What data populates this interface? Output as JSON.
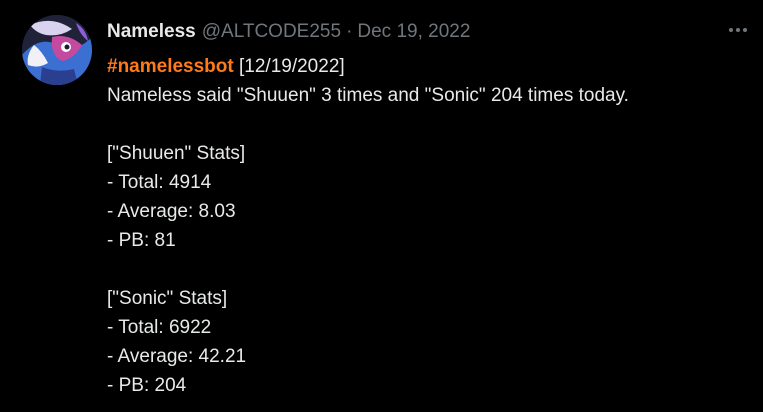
{
  "author": {
    "display_name": "Nameless",
    "handle": "@ALTCODE255",
    "separator": "·",
    "date": "Dec 19, 2022"
  },
  "tweet": {
    "hashtag": "#namelessbot",
    "date_tag": "[12/19/2022]",
    "lines": [
      "Nameless said \"Shuuen\" 3 times and \"Sonic\" 204 times today.",
      "",
      "[\"Shuuen\" Stats]",
      "- Total: 4914",
      "- Average: 8.03",
      "- PB: 81",
      "",
      "[\"Sonic\" Stats]",
      "- Total: 6922",
      "- Average: 42.21",
      "- PB: 204"
    ]
  },
  "icons": {
    "more": "more-horizontal-icon",
    "avatar": "profile-avatar"
  },
  "colors": {
    "background": "#000000",
    "text": "#e7e9ea",
    "muted": "#71767b",
    "hashtag": "#ff7a1a"
  }
}
